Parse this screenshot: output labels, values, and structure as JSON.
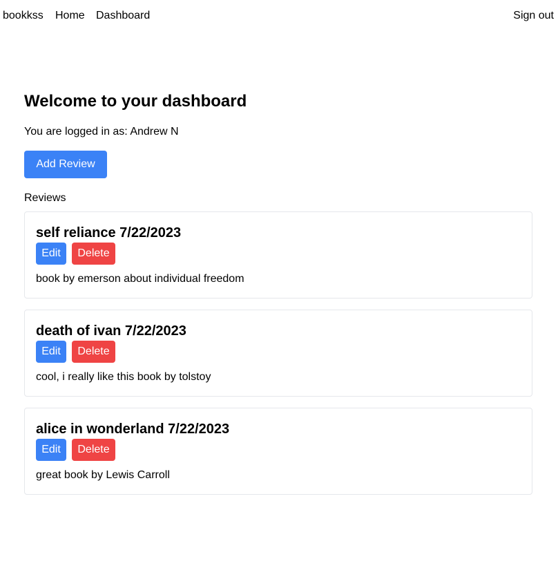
{
  "nav": {
    "brand": "bookkss",
    "links": [
      "Home",
      "Dashboard"
    ],
    "sign_out": "Sign out"
  },
  "dashboard": {
    "title": "Welcome to your dashboard",
    "logged_in_text": "You are logged in as: Andrew N",
    "add_review_label": "Add Review",
    "reviews_label": "Reviews"
  },
  "reviews": [
    {
      "title": "self reliance 7/22/2023",
      "body": "book by emerson about individual freedom",
      "edit_label": "Edit",
      "delete_label": "Delete"
    },
    {
      "title": "death of ivan 7/22/2023",
      "body": "cool, i really like this book by tolstoy",
      "edit_label": "Edit",
      "delete_label": "Delete"
    },
    {
      "title": "alice in wonderland 7/22/2023",
      "body": "great book by Lewis Carroll",
      "edit_label": "Edit",
      "delete_label": "Delete"
    }
  ],
  "colors": {
    "primary": "#3b82f6",
    "danger": "#ef4444",
    "card_border": "#e5e7eb"
  }
}
